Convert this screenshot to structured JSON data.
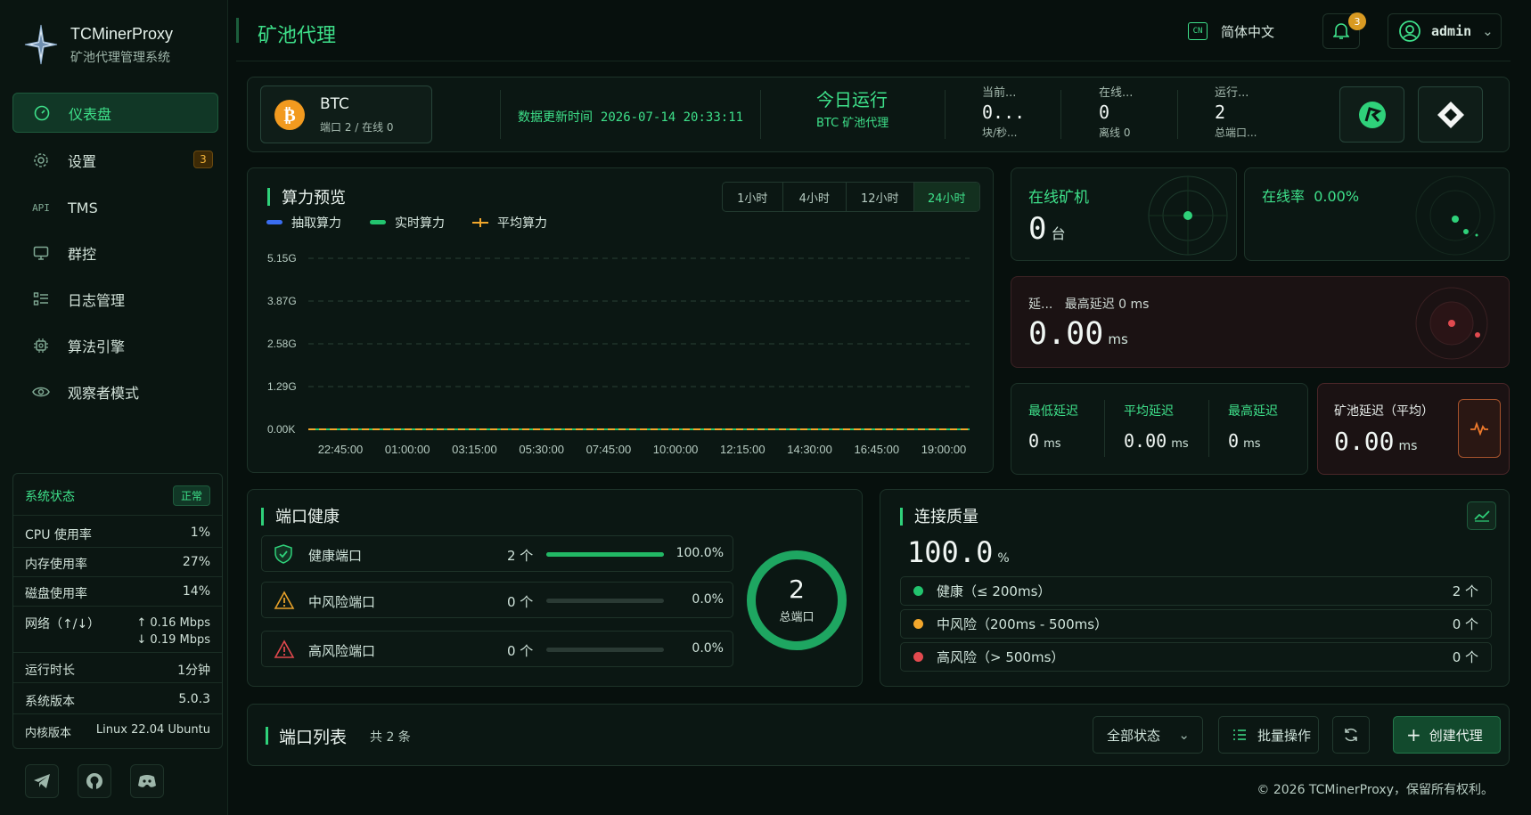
{
  "brand": {
    "title": "TCMinerProxy",
    "subtitle": "矿池代理管理系统"
  },
  "sidebar": {
    "items": [
      {
        "label": "仪表盘",
        "icon": "dashboard-icon"
      },
      {
        "label": "设置",
        "icon": "gear-icon",
        "badge": "3"
      },
      {
        "label": "TMS",
        "icon": "api-icon",
        "icon_text": "API"
      },
      {
        "label": "群控",
        "icon": "monitor-icon"
      },
      {
        "label": "日志管理",
        "icon": "list-icon"
      },
      {
        "label": "算法引擎",
        "icon": "chip-icon"
      },
      {
        "label": "观察者模式",
        "icon": "eye-icon"
      }
    ],
    "system": {
      "title": "系统状态",
      "status": "正常",
      "cpu_label": "CPU 使用率",
      "cpu": "1%",
      "mem_label": "内存使用率",
      "mem": "27%",
      "disk_label": "磁盘使用率",
      "disk": "14%",
      "net_label": "网络（↑/↓）",
      "net_up": "↑ 0.16 Mbps",
      "net_down": "↓ 0.19 Mbps",
      "uptime_label": "运行时长",
      "uptime": "1分钟",
      "version_label": "系统版本",
      "version": "5.0.3",
      "kernel_label": "内核版本",
      "kernel": "Linux 22.04 Ubuntu"
    }
  },
  "header": {
    "title": "矿池代理",
    "lang_icon_text": "CN",
    "lang": "简体中文",
    "notif_count": "3",
    "user": "admin"
  },
  "overview": {
    "coin": "BTC",
    "coin_sub": "端口 2 / 在线 0",
    "update_label": "数据更新时间",
    "update_time": "2026-07-14 20:33:11",
    "today_title": "今日运行",
    "today_sub": "BTC 矿池代理",
    "stats": [
      {
        "label": "当前...",
        "value": "0...",
        "sub": "块/秒..."
      },
      {
        "label": "在线...",
        "value": "0",
        "sub": "离线 0"
      },
      {
        "label": "运行...",
        "value": "2",
        "sub": "总端口..."
      }
    ]
  },
  "hashrate": {
    "title": "算力预览",
    "timeframes": [
      "1小时",
      "4小时",
      "12小时",
      "24小时"
    ],
    "active_timeframe": 3,
    "legend": [
      "抽取算力",
      "实时算力",
      "平均算力"
    ]
  },
  "chart_data": {
    "type": "line",
    "x": [
      "22:45:00",
      "01:00:00",
      "03:15:00",
      "05:30:00",
      "07:45:00",
      "10:00:00",
      "12:15:00",
      "14:30:00",
      "16:45:00",
      "19:00:00"
    ],
    "y_ticks": [
      "5.15G",
      "3.87G",
      "2.58G",
      "1.29G",
      "0.00K"
    ],
    "ylim": [
      0,
      5.15
    ],
    "series": [
      {
        "name": "抽取算力",
        "color": "#3a6df0",
        "values": [
          0,
          0,
          0,
          0,
          0,
          0,
          0,
          0,
          0,
          0
        ]
      },
      {
        "name": "实时算力",
        "color": "#22c46e",
        "values": [
          0,
          0,
          0,
          0,
          0,
          0,
          0,
          0,
          0,
          0
        ]
      },
      {
        "name": "平均算力",
        "color": "#f2a72c",
        "values": [
          0,
          0,
          0,
          0,
          0,
          0,
          0,
          0,
          0,
          0
        ]
      }
    ],
    "grid": true,
    "legend_position": "top-left"
  },
  "cards": {
    "online_miners_label": "在线矿机",
    "online_miners": "0",
    "online_miners_unit": "台",
    "online_rate_label": "在线率",
    "online_rate": "0.00%",
    "latency_label": "延...",
    "latency_max_label": "最高延迟 0 ms",
    "latency": "0.00",
    "latency_unit": "ms",
    "min_label": "最低延迟",
    "min": "0",
    "avg_label": "平均延迟",
    "avg": "0.00",
    "max_label": "最高延迟",
    "max": "0",
    "ms": "ms",
    "pool_label": "矿池延迟（平均）",
    "pool": "0.00",
    "pool_unit": "ms"
  },
  "port_health": {
    "title": "端口健康",
    "rows": [
      {
        "label": "健康端口",
        "count": "2 个",
        "pct": "100.0%",
        "fraction": 1.0,
        "color": "#22b865"
      },
      {
        "label": "中风险端口",
        "count": "0 个",
        "pct": "0.0%",
        "fraction": 0,
        "color": "#e6a02a"
      },
      {
        "label": "高风险端口",
        "count": "0 个",
        "pct": "0.0%",
        "fraction": 0,
        "color": "#e0484d"
      }
    ],
    "total": "2",
    "total_label": "总端口"
  },
  "quality": {
    "title": "连接质量",
    "value": "100.0",
    "unit": "%",
    "rows": [
      {
        "label": "健康（≤ 200ms）",
        "count": "2 个",
        "color": "#22c46e"
      },
      {
        "label": "中风险（200ms - 500ms）",
        "count": "0 个",
        "color": "#f2a72c"
      },
      {
        "label": "高风险（> 500ms）",
        "count": "0 个",
        "color": "#e24a4f"
      }
    ]
  },
  "port_list": {
    "title": "端口列表",
    "count": "共 2 条",
    "filter": "全部状态",
    "batch": "批量操作",
    "create": "创建代理"
  },
  "footer": "© 2026 TCMinerProxy，保留所有权利。"
}
